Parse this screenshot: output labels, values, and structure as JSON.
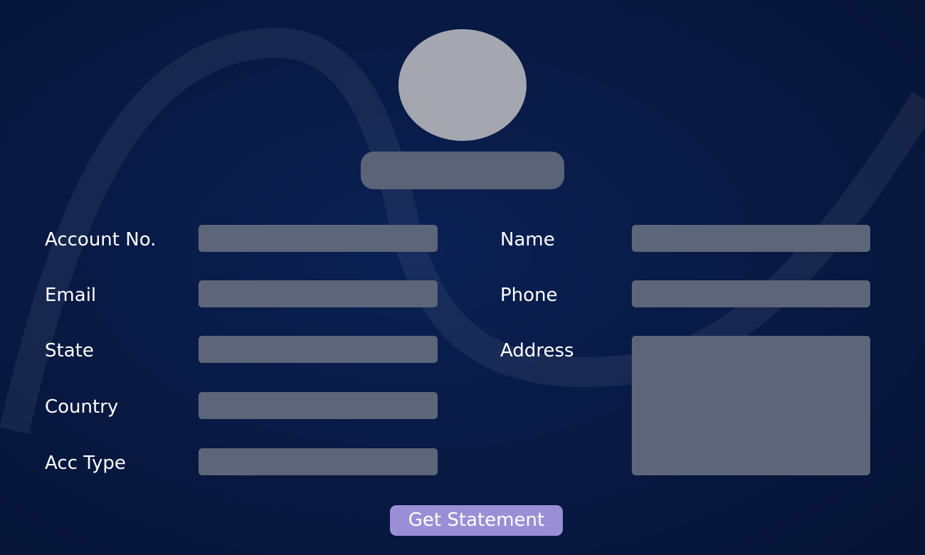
{
  "profile": {
    "avatar_icon": "user-avatar-placeholder",
    "avatar_color": "#a4a7b0",
    "name_display": ""
  },
  "form": {
    "left": [
      {
        "label": "Account No.",
        "value": ""
      },
      {
        "label": "Email",
        "value": ""
      },
      {
        "label": "State",
        "value": ""
      },
      {
        "label": "Country",
        "value": ""
      },
      {
        "label": "Acc Type",
        "value": ""
      }
    ],
    "right": [
      {
        "label": "Name",
        "value": ""
      },
      {
        "label": "Phone",
        "value": ""
      },
      {
        "label": "Address",
        "value": ""
      }
    ]
  },
  "actions": {
    "get_statement_label": "Get Statement"
  },
  "colors": {
    "background": "#081a45",
    "input_fill": "#5d6579",
    "button_accent": "#9a8fd6",
    "text": "#ffffff"
  }
}
